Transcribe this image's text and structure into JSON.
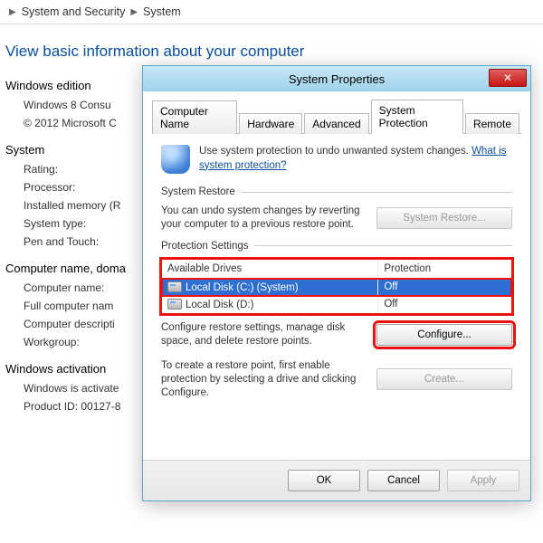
{
  "breadcrumb": {
    "item1": "System and Security",
    "item2": "System"
  },
  "page_title": "View basic information about your computer",
  "bg": {
    "edition_head": "Windows edition",
    "edition_line1": "Windows 8 Consu",
    "edition_line2": "© 2012 Microsoft C",
    "system_head": "System",
    "rating": "Rating:",
    "processor": "Processor:",
    "ram": "Installed memory (R",
    "systype": "System type:",
    "pentouch": "Pen and Touch:",
    "cnd_head": "Computer name, doma",
    "cname": "Computer name:",
    "fullname": "Full computer nam",
    "cdesc": "Computer descripti",
    "workgroup": "Workgroup:",
    "act_head": "Windows activation",
    "activated": "Windows is activate",
    "pid": "Product ID: 00127-8"
  },
  "dialog": {
    "title": "System Properties",
    "close_glyph": "✕",
    "tabs": {
      "t0": "Computer Name",
      "t1": "Hardware",
      "t2": "Advanced",
      "t3": "System Protection",
      "t4": "Remote"
    },
    "intro_text": "Use system protection to undo unwanted system changes. ",
    "intro_link": "What is system protection?",
    "restore": {
      "title": "System Restore",
      "text": "You can undo system changes by reverting your computer to a previous restore point.",
      "button": "System Restore..."
    },
    "protection": {
      "title": "Protection Settings",
      "head_drive": "Available Drives",
      "head_prot": "Protection",
      "drives": {
        "d0_name": "Local Disk (C:) (System)",
        "d0_prot": "Off",
        "d1_name": "Local Disk (D:)",
        "d1_prot": "Off"
      },
      "cfg_text": "Configure restore settings, manage disk space, and delete restore points.",
      "cfg_button": "Configure...",
      "create_text": "To create a restore point, first enable protection by selecting a drive and clicking Configure.",
      "create_button": "Create..."
    },
    "buttons": {
      "ok": "OK",
      "cancel": "Cancel",
      "apply": "Apply"
    }
  }
}
